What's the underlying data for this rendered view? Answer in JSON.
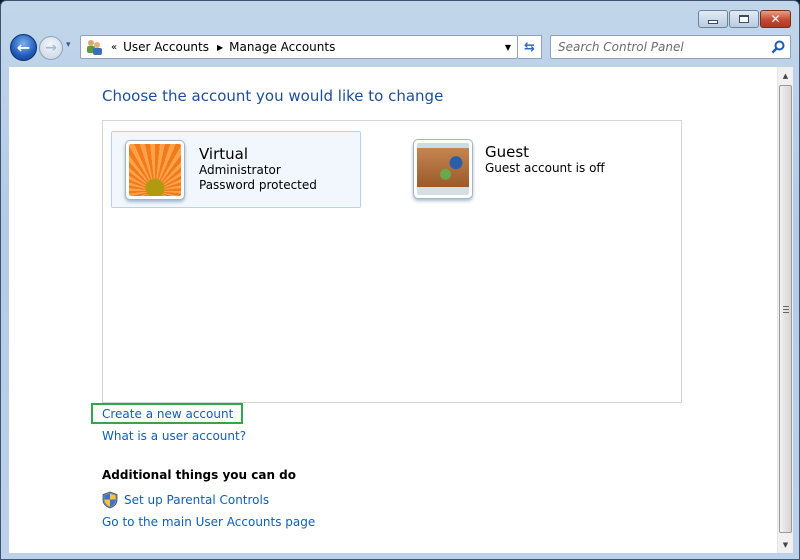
{
  "window": {
    "caption_buttons": {
      "minimize": "minimize",
      "maximize": "maximize",
      "close": "✕"
    }
  },
  "nav": {
    "back_icon": "←",
    "forward_icon": "→",
    "recent_icon": "▾",
    "address": {
      "overflow": "«",
      "breadcrumb": [
        "User Accounts",
        "Manage Accounts"
      ],
      "separator": "▶",
      "dropdown_icon": "▼"
    },
    "refresh_icon": "⇆",
    "search": {
      "placeholder": "Search Control Panel",
      "value": ""
    }
  },
  "main": {
    "title": "Choose the account you would like to change",
    "accounts": [
      {
        "name": "Virtual",
        "lines": [
          "Administrator",
          "Password protected"
        ],
        "picture": "orange-flower",
        "selected": true
      },
      {
        "name": "Guest",
        "lines": [
          "Guest account is off"
        ],
        "picture": "suitcase",
        "selected": false
      }
    ],
    "links": {
      "create": "Create a new account",
      "what": "What is a user account?"
    },
    "additional": {
      "heading": "Additional things you can do",
      "parental": "Set up Parental Controls",
      "main_page": "Go to the main User Accounts page"
    }
  },
  "colors": {
    "link": "#0f5fb8",
    "title": "#1e4e9c",
    "highlight_box": "#2ea84a"
  }
}
